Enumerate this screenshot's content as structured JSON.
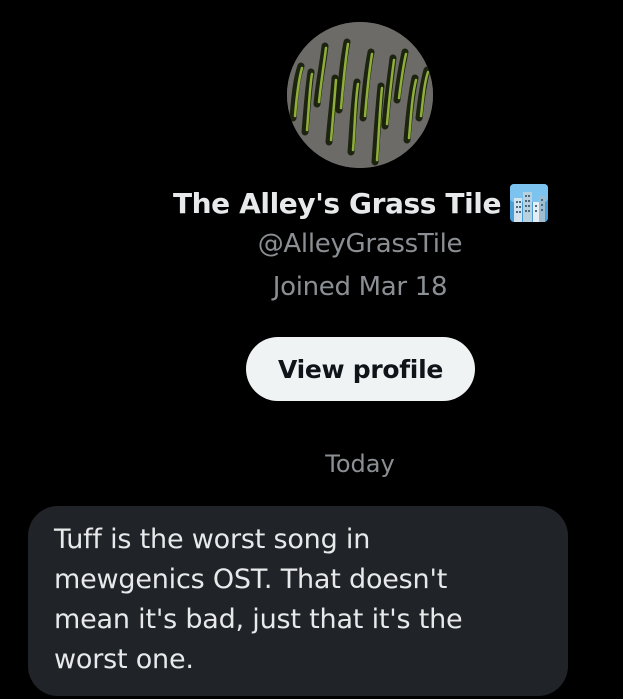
{
  "profile": {
    "display_name": "The Alley's Grass Tile",
    "name_emoji_icon": "cityscape-icon",
    "handle": "@AlleyGrassTile",
    "joined": "Joined Mar 18",
    "view_profile_label": "View profile",
    "avatar_icon": "grass-tile-avatar"
  },
  "conversation": {
    "date_separator": "Today",
    "messages": [
      {
        "text": "Tuff is the worst song in\nmewgenics OST. That doesn't\nmean it's bad, just that it's the\nworst one."
      }
    ]
  },
  "colors": {
    "background": "#000000",
    "primary_text": "#e7e9ea",
    "secondary_text": "#8b8f94",
    "button_bg": "#eff3f4",
    "button_text": "#0f1419",
    "bubble_bg": "#202327"
  }
}
